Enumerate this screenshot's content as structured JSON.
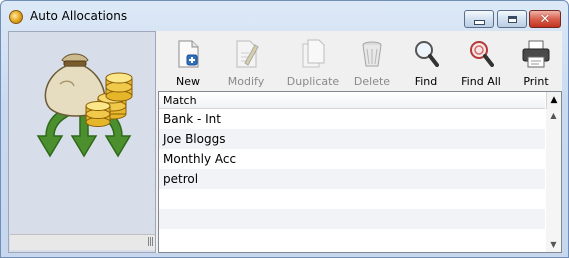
{
  "window": {
    "title": "Auto Allocations",
    "close_glyph": "✕"
  },
  "toolbar": {
    "buttons": [
      {
        "label": "New",
        "icon": "new-document-icon",
        "enabled": true
      },
      {
        "label": "Modify",
        "icon": "modify-document-icon",
        "enabled": false
      },
      {
        "label": "Duplicate",
        "icon": "duplicate-document-icon",
        "enabled": false
      },
      {
        "label": "Delete",
        "icon": "recycle-bin-icon",
        "enabled": false
      },
      {
        "label": "Find",
        "icon": "magnifier-icon",
        "enabled": true
      },
      {
        "label": "Find All",
        "icon": "find-all-magnifier-icon",
        "enabled": true
      },
      {
        "label": "Print",
        "icon": "printer-icon",
        "enabled": true
      }
    ]
  },
  "list": {
    "column_header": "Match",
    "sort_glyph": "▲",
    "rows": [
      "Bank - Int",
      "Joe Bloggs",
      "Monthly Acc",
      "petrol"
    ]
  },
  "scrollbar": {
    "up": "▲",
    "down": "▼"
  },
  "status": {
    "grip": "|||"
  },
  "colors": {
    "titlebar": "#c9daf0",
    "close_button": "#d9614e",
    "left_panel": "#d7dde9",
    "allocation_arrows": "#4c8f2e",
    "coin_gold": "#e5b52a"
  }
}
